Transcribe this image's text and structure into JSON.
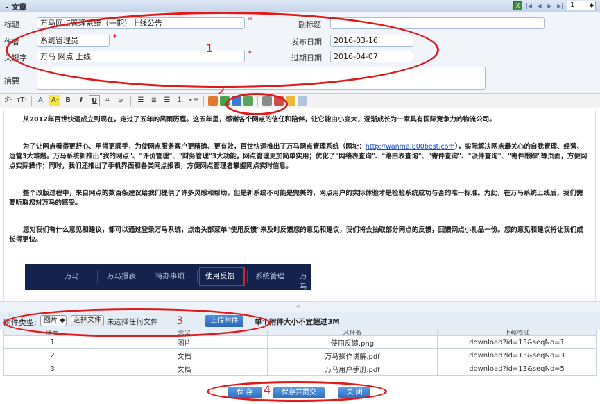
{
  "panel": {
    "title": "- 文章",
    "page_value": "1"
  },
  "form": {
    "title_label": "标题",
    "title_value": "万马网点管理系统（一期）上线公告",
    "subtitle_label": "副标题",
    "subtitle_value": "",
    "author_label": "作者",
    "author_value": "系统管理员",
    "publish_label": "发布日期",
    "publish_value": "2016-03-16",
    "keyword_label": "关键字",
    "keyword_value": "万马 网点 上线",
    "expire_label": "过期日期",
    "expire_value": "2016-04-07",
    "summary_label": "摘要",
    "required_mark": "*"
  },
  "toolbar": {
    "font_family": "ℱ·",
    "font_size": "тT·",
    "font_color": "A·",
    "bg_color": "A·",
    "bold": "B",
    "italic": "I",
    "underline": "U",
    "strike": "⌗",
    "eraser": "⌀"
  },
  "editor": {
    "p1": "从2012年百世快运成立到现在，走过了五年的风雨历程。这五年里，感谢各个网点的信任和陪伴，让它能由小变大，逐渐成长为一家具有国际竞争力的物流公司。",
    "p2a": "为了让网点看得更舒心、用得更顺手，为使网点服务客户更精确、更有效，百世快运推出了万马网点管理系统（网址：",
    "p2link": "http://wanma.800best.com",
    "p2b": "），实际解决网点最关心的自我管理、经营、运营3大难题。万马系统新推出\"我的网点\"、\"评价管理\"、\"财务管理\"3大功能，网点管理更加简单实用；优化了\"网络表查询\"、\"路由表查询\"、\"寄件查询\"、\"派件查询\"、\"寄件跟踪\"等页面，方便网点实际操作；同时，我们还推出了手机界面和各类网点报表，方便网点管理者掌握网点实时信息。",
    "p3": "整个改版过程中，来自网点的数百条建议给我们提供了许多灵感和帮助。但是新系统不可能是完美的，网点用户的实际体验才是检验系统成功与否的唯一标准。为此，在万马系统上线后，我们需要听取您对万马的感受。",
    "p4": "您对我们有什么意见和建议，都可以通过登录万马系统，点击头部菜单\"使用反馈\"来及时反馈您的意见和建议，我们将会抽取部分网点的反馈，回馈网点小礼品一份。您的意见和建议将让我们成长得更快。",
    "nav_items": [
      "万马",
      "万马报表",
      "待办事项",
      "使用反馈",
      "系统管理",
      "万马"
    ]
  },
  "attach": {
    "type_label": "附件类型:",
    "type_value": "图片 ◆",
    "choose_file": "选择文件",
    "no_file": "未选择任何文件",
    "upload": "上传附件",
    "hint": "单个附件大小不宜超过3M"
  },
  "table": {
    "headers": [
      "序号",
      "类型",
      "文件名",
      "下载地址"
    ],
    "rows": [
      [
        "1",
        "图片",
        "使用反馈.png",
        "download?id=13&seqNo=1"
      ],
      [
        "2",
        "文档",
        "万马操作讲解.pdf",
        "download?id=13&seqNo=3"
      ],
      [
        "3",
        "文档",
        "万马用户手册.pdf",
        "download?id=13&seqNo=5"
      ]
    ]
  },
  "buttons": {
    "save": "保 存",
    "save_submit": "保存并提交",
    "close": "关 闭"
  },
  "annotations": [
    "1",
    "2",
    "3",
    "4"
  ],
  "colors": {
    "annotation_red": "#e0191b",
    "button_blue": "#2d6cc0",
    "nav_dark": "#13234d"
  }
}
